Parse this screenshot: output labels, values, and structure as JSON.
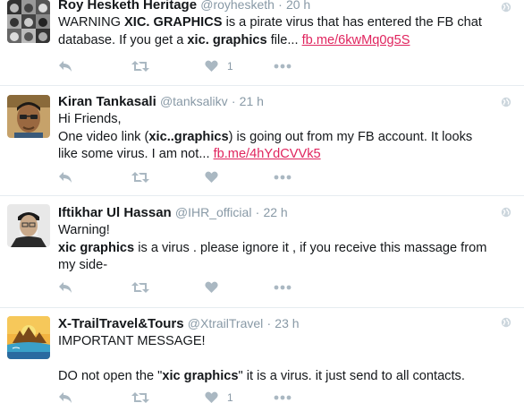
{
  "tweets": [
    {
      "name": "Roy Hesketh Heritage",
      "handle": "@royhesketh",
      "time": "20 h",
      "body": [
        {
          "t": "WARNING "
        },
        {
          "t": "XIC. GRAPHICS",
          "b": true
        },
        {
          "t": " is a pirate virus that has entered the FB chat database. If you get a "
        },
        {
          "t": "xic. graphics",
          "b": true
        },
        {
          "t": " file... "
        },
        {
          "t": "fb.me/6kwMq0g5S",
          "link": true
        }
      ],
      "likes": "1"
    },
    {
      "name": "Kiran Tankasali",
      "handle": "@tanksalikv",
      "time": "21 h",
      "body": [
        {
          "t": "Hi Friends,"
        },
        {
          "br": true
        },
        {
          "t": "One video link ("
        },
        {
          "t": "xic..graphics",
          "b": true
        },
        {
          "t": ") is going out from my FB account. It looks like some virus. I am not... "
        },
        {
          "t": "fb.me/4hYdCVVk5",
          "link": true
        }
      ],
      "likes": ""
    },
    {
      "name": "Iftikhar Ul Hassan",
      "handle": "@IHR_official",
      "time": "22 h",
      "body": [
        {
          "t": "Warning!"
        },
        {
          "br": true
        },
        {
          "t": "xic graphics",
          "b": true
        },
        {
          "t": " is a virus . please ignore it , if you receive this massage from my side-"
        }
      ],
      "likes": ""
    },
    {
      "name": "X-TrailTravel&Tours",
      "handle": "@XtrailTravel",
      "time": "23 h",
      "body": [
        {
          "t": "IMPORTANT MESSAGE!"
        },
        {
          "br": true
        },
        {
          "br": true
        },
        {
          "t": "DO not open the \""
        },
        {
          "t": "xic graphics",
          "b": true
        },
        {
          "t": "\" it is a virus. it just send to all contacts."
        }
      ],
      "likes": "1"
    }
  ],
  "icons": {
    "reply": "reply-icon",
    "retweet": "retweet-icon",
    "like": "heart-icon",
    "more": "more-icon",
    "globe": "globe-icon"
  },
  "colors": {
    "icon": "#aab8c2",
    "link": "#e0245e",
    "meta": "#8899a6"
  }
}
